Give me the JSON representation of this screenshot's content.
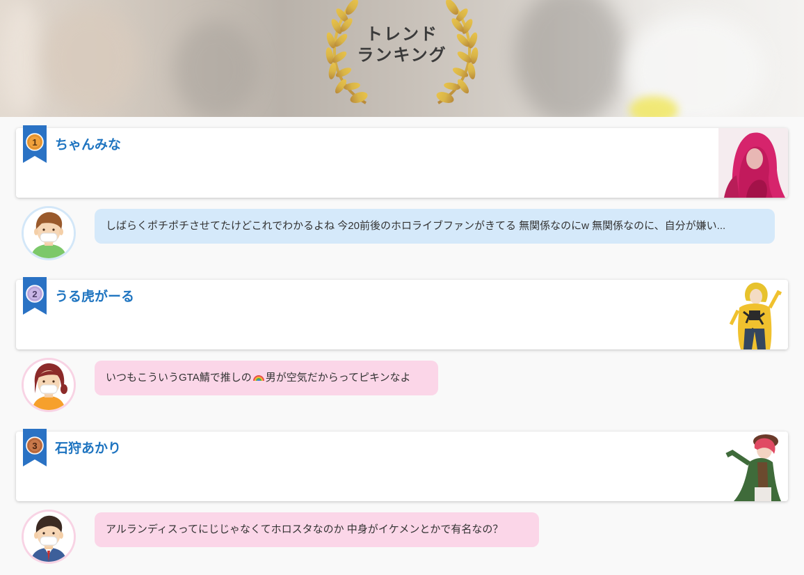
{
  "banner": {
    "title_line1": "トレンド",
    "title_line2": "ランキング",
    "wreath_icon": "laurel-wreath-icon",
    "colors": {
      "gold": "#d4a93a"
    }
  },
  "colors": {
    "accent_name": "#1e74c0",
    "ribbon_blue": "#2a72c4",
    "rank1_medal": "#f0a13c",
    "rank2_medal": "#c9b6e6",
    "rank3_medal": "#c8784a",
    "bubble_blue": "#d5e9fa",
    "bubble_pink": "#fbd6e8"
  },
  "rankings": [
    {
      "rank": "1",
      "name": "ちゃんみな",
      "comment": "しばらくポチポチさせてたけどこれでわかるよね 今20前後のホロライブファンがきてる 無関係なのにw 無関係なのに、自分が嫌い...",
      "avatar": "boy-with-mask-avatar",
      "bubble_color": "blue"
    },
    {
      "rank": "2",
      "name": "うる虎がーる",
      "comment_before": "いつもこういうGTA鯖で推しの",
      "comment_icon": "rainbow-emoji",
      "comment_after": "男が空気だからってピキンなよ",
      "avatar": "girl-with-mask-avatar",
      "bubble_color": "pink"
    },
    {
      "rank": "3",
      "name": "石狩あかり",
      "comment": "アルランディスってにじじゃなくてホロスタなのか 中身がイケメンとかで有名なの？",
      "avatar": "man-in-suit-avatar",
      "bubble_color": "pink"
    }
  ]
}
